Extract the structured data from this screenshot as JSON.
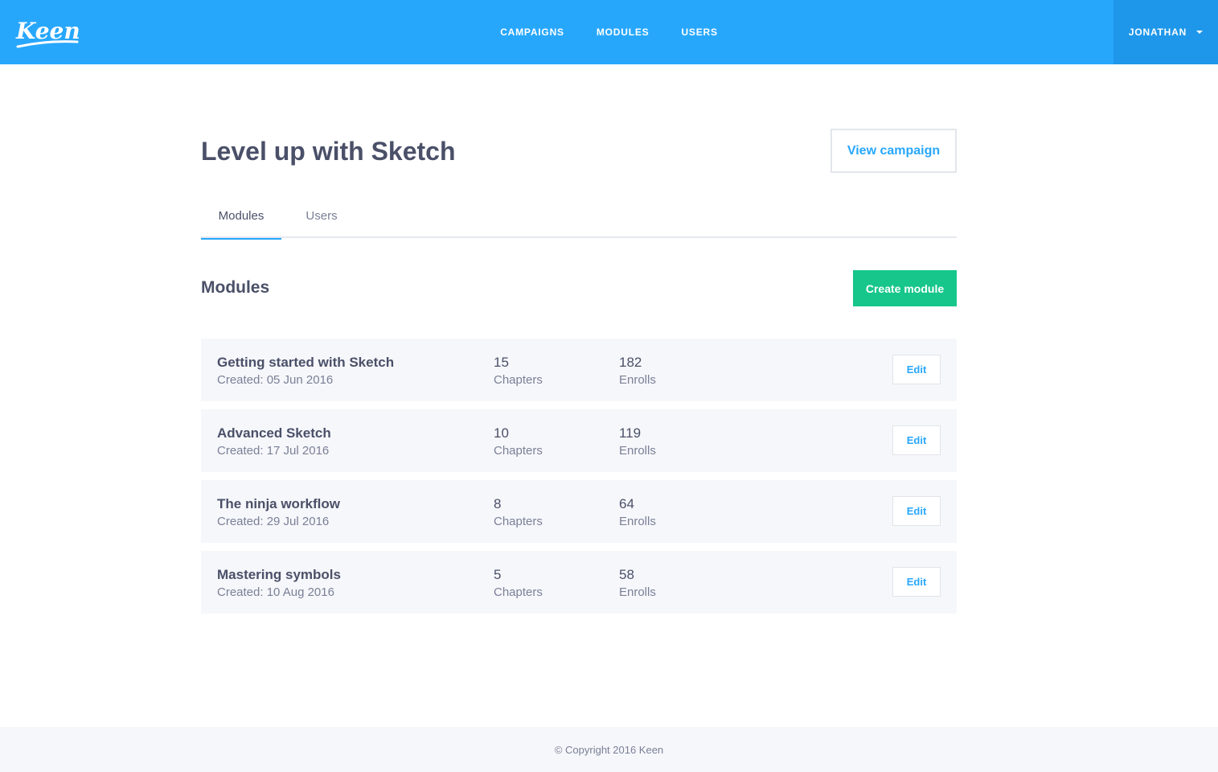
{
  "header": {
    "logo_text": "Keen",
    "nav": [
      "CAMPAIGNS",
      "MODULES",
      "USERS"
    ],
    "user": "JONATHAN"
  },
  "page": {
    "title": "Level up with Sketch",
    "view_campaign_label": "View campaign",
    "tabs": [
      "Modules",
      "Users"
    ],
    "section_title": "Modules",
    "create_label": "Create module"
  },
  "modules": [
    {
      "name": "Getting started with Sketch",
      "created": "Created: 05 Jun 2016",
      "chapters": "15",
      "chapters_label": "Chapters",
      "enrolls": "182",
      "enrolls_label": "Enrolls",
      "edit_label": "Edit"
    },
    {
      "name": "Advanced Sketch",
      "created": "Created: 17 Jul 2016",
      "chapters": "10",
      "chapters_label": "Chapters",
      "enrolls": "119",
      "enrolls_label": "Enrolls",
      "edit_label": "Edit"
    },
    {
      "name": "The ninja workflow",
      "created": "Created: 29 Jul 2016",
      "chapters": "8",
      "chapters_label": "Chapters",
      "enrolls": "64",
      "enrolls_label": "Enrolls",
      "edit_label": "Edit"
    },
    {
      "name": "Mastering symbols",
      "created": "Created: 10 Aug 2016",
      "chapters": "5",
      "chapters_label": "Chapters",
      "enrolls": "58",
      "enrolls_label": "Enrolls",
      "edit_label": "Edit"
    }
  ],
  "footer": {
    "copyright": "© Copyright 2016 Keen"
  },
  "colors": {
    "brand_blue": "#27a7fc",
    "user_menu_blue": "#1e97ea",
    "create_green": "#16c68b",
    "row_bg": "#f6f7fb"
  }
}
